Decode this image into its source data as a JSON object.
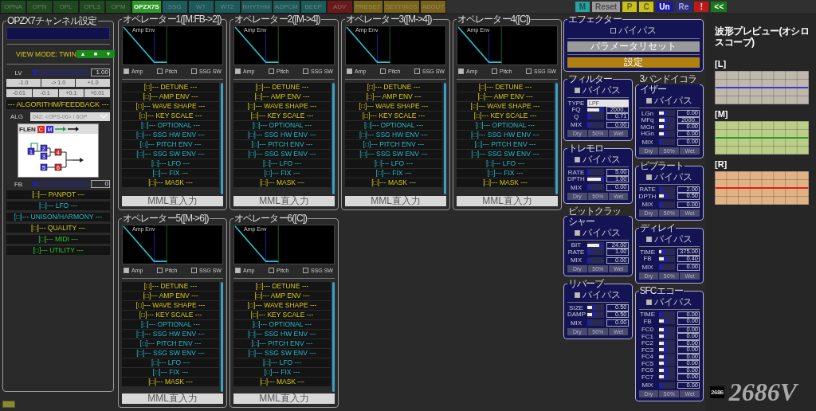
{
  "tabs": [
    {
      "label": "OPNA",
      "selected": false,
      "color": "#1e4a1e"
    },
    {
      "label": "OPN",
      "selected": false,
      "color": "#1e4a1e"
    },
    {
      "label": "OPL",
      "selected": false,
      "color": "#1e4a1e"
    },
    {
      "label": "OPL3",
      "selected": false,
      "color": "#1e4a1e"
    },
    {
      "label": "OPM",
      "selected": false,
      "color": "#1e4a1e"
    },
    {
      "label": "OPZX7S",
      "selected": true,
      "color": "#2e9a2e"
    },
    {
      "label": "SSG",
      "selected": false,
      "color": "#1d5a5a"
    },
    {
      "label": "WT",
      "selected": false,
      "color": "#1d5a5a"
    },
    {
      "label": "WT2",
      "selected": false,
      "color": "#1d5a5a"
    },
    {
      "label": "RHYTHM",
      "selected": false,
      "color": "#1d5a5a"
    },
    {
      "label": "ADPCM",
      "selected": false,
      "color": "#1d5a5a"
    },
    {
      "label": "BEEP",
      "selected": false,
      "color": "#1d5a5a"
    },
    {
      "label": "ADV",
      "selected": false,
      "color": "#6a1a1a"
    },
    {
      "label": "PRESET",
      "selected": false,
      "color": "#7a6418"
    },
    {
      "label": "SETTINGS",
      "selected": false,
      "color": "#7a6418"
    },
    {
      "label": "ABOUT",
      "selected": false,
      "color": "#7a6418"
    }
  ],
  "toolbar_buttons": [
    {
      "label": "M",
      "color": "#2aa0a0",
      "disabled": true
    },
    {
      "label": "Reset",
      "color": "#9a9a9a",
      "disabled": true
    },
    {
      "label": "P",
      "color": "#c8c020",
      "disabled": true
    },
    {
      "label": "C",
      "color": "#c8c020",
      "disabled": true
    },
    {
      "label": "Un",
      "color": "#1a1aa0",
      "disabled": false
    },
    {
      "label": "Re",
      "color": "#2a2a80",
      "disabled": true
    },
    {
      "label": "!",
      "color": "#c01818",
      "disabled": false
    },
    {
      "label": "<<",
      "color": "#1a7a1a",
      "disabled": false
    }
  ],
  "channel_panel": {
    "title": "OPZX7チャンネル設定",
    "view_mode": "VIEW MODE: TWIN",
    "view_buttons": [
      "▲",
      "■",
      "▼"
    ],
    "lv": {
      "label": "LV",
      "level": 0.05,
      "value": "1.00"
    },
    "step_buttons": [
      [
        "-1.0",
        "-> 1.0",
        "+1.0"
      ],
      [
        "-0.01",
        "-0.1",
        "+0.1",
        "+0.01"
      ]
    ],
    "algorithm_header": "--- ALGORITHM/FEEDBACK ---",
    "alg": {
      "label": "ALG",
      "value": "042: <OPS-06> / 6OP"
    },
    "diagram": {
      "label": "FLEN",
      "tools": [
        {
          "label": "C",
          "kind": "carrier"
        },
        {
          "label": "M",
          "kind": "modulator"
        }
      ],
      "nodes": [
        {
          "label": "1",
          "kind": "modulator"
        },
        {
          "label": "2",
          "kind": "modulator"
        },
        {
          "label": "3",
          "kind": "modulator"
        },
        {
          "label": "4",
          "kind": "carrier"
        },
        {
          "label": "5",
          "kind": "modulator"
        },
        {
          "label": "6",
          "kind": "carrier"
        }
      ]
    },
    "fb": {
      "label": "FB",
      "level": 0.0,
      "value": "0"
    },
    "sections": [
      {
        "label": "[□]--- PANPOT ---",
        "kind": "primary"
      },
      {
        "label": "[□]--- LFO ---",
        "kind": "extended"
      },
      {
        "label": "[□]--- UNISON/HARMONY ---",
        "kind": "extended"
      },
      {
        "label": "[□]--- QUALITY ---",
        "kind": "primary"
      },
      {
        "label": "[□]--- MIDI ---",
        "kind": "system"
      },
      {
        "label": "[□]--- UTILITY ---",
        "kind": "system"
      }
    ]
  },
  "operators": [
    {
      "title": "オペレーター1([M:FB->2])",
      "graph_label": "Amp Env",
      "checks": [
        {
          "label": "Amp",
          "checked": true
        },
        {
          "label": "Pitch",
          "checked": false
        },
        {
          "label": "SSG SW",
          "checked": false
        }
      ],
      "sections": [
        {
          "label": "[□]--- DETUNE ---",
          "kind": "primary"
        },
        {
          "label": "[□]--- AMP ENV ---",
          "kind": "primary"
        },
        {
          "label": "[□]--- WAVE SHAPE ---",
          "kind": "primary"
        },
        {
          "label": "[□]--- KEY SCALE ---",
          "kind": "primary"
        },
        {
          "label": "[□]--- OPTIONAL ---",
          "kind": "extended"
        },
        {
          "label": "[□]--- SSG HW ENV ---",
          "kind": "extended"
        },
        {
          "label": "[□]--- PITCH ENV ---",
          "kind": "extended"
        },
        {
          "label": "[□]--- SSG SW ENV ---",
          "kind": "extended"
        },
        {
          "label": "[□]--- LFO ---",
          "kind": "extended"
        },
        {
          "label": "[□]--- FIX ---",
          "kind": "extended"
        },
        {
          "label": "[□]--- MASK ---",
          "kind": "primary"
        }
      ],
      "mml_button": "MML直入力"
    },
    {
      "title": "オペレーター2([M->4])",
      "graph_label": "Amp Env",
      "checks": [
        {
          "label": "Amp",
          "checked": true
        },
        {
          "label": "Pitch",
          "checked": false
        },
        {
          "label": "SSG SW",
          "checked": false
        }
      ],
      "sections": [
        {
          "label": "[□]--- DETUNE ---",
          "kind": "primary"
        },
        {
          "label": "[□]--- AMP ENV ---",
          "kind": "primary"
        },
        {
          "label": "[□]--- WAVE SHAPE ---",
          "kind": "primary"
        },
        {
          "label": "[□]--- KEY SCALE ---",
          "kind": "primary"
        },
        {
          "label": "[□]--- OPTIONAL ---",
          "kind": "extended"
        },
        {
          "label": "[□]--- SSG HW ENV ---",
          "kind": "extended"
        },
        {
          "label": "[□]--- PITCH ENV ---",
          "kind": "extended"
        },
        {
          "label": "[□]--- SSG SW ENV ---",
          "kind": "extended"
        },
        {
          "label": "[□]--- LFO ---",
          "kind": "extended"
        },
        {
          "label": "[□]--- FIX ---",
          "kind": "extended"
        },
        {
          "label": "[□]--- MASK ---",
          "kind": "primary"
        }
      ],
      "mml_button": "MML直入力"
    },
    {
      "title": "オペレーター3([M->4])",
      "graph_label": "Amp Env",
      "checks": [
        {
          "label": "Amp",
          "checked": true
        },
        {
          "label": "Pitch",
          "checked": false
        },
        {
          "label": "SSG SW",
          "checked": false
        }
      ],
      "sections": [
        {
          "label": "[□]--- DETUNE ---",
          "kind": "primary"
        },
        {
          "label": "[□]--- AMP ENV ---",
          "kind": "primary"
        },
        {
          "label": "[□]--- WAVE SHAPE ---",
          "kind": "primary"
        },
        {
          "label": "[□]--- KEY SCALE ---",
          "kind": "primary"
        },
        {
          "label": "[□]--- OPTIONAL ---",
          "kind": "extended"
        },
        {
          "label": "[□]--- SSG HW ENV ---",
          "kind": "extended"
        },
        {
          "label": "[□]--- PITCH ENV ---",
          "kind": "extended"
        },
        {
          "label": "[□]--- SSG SW ENV ---",
          "kind": "extended"
        },
        {
          "label": "[□]--- LFO ---",
          "kind": "extended"
        },
        {
          "label": "[□]--- FIX ---",
          "kind": "extended"
        },
        {
          "label": "[□]--- MASK ---",
          "kind": "primary"
        }
      ],
      "mml_button": "MML直入力"
    },
    {
      "title": "オペレーター4([C])",
      "graph_label": "Amp Env",
      "checks": [
        {
          "label": "Amp",
          "checked": true
        },
        {
          "label": "Pitch",
          "checked": false
        },
        {
          "label": "SSG SW",
          "checked": false
        }
      ],
      "sections": [
        {
          "label": "[□]--- DETUNE ---",
          "kind": "primary"
        },
        {
          "label": "[□]--- AMP ENV ---",
          "kind": "primary"
        },
        {
          "label": "[□]--- WAVE SHAPE ---",
          "kind": "primary"
        },
        {
          "label": "[□]--- KEY SCALE ---",
          "kind": "primary"
        },
        {
          "label": "[□]--- OPTIONAL ---",
          "kind": "extended"
        },
        {
          "label": "[□]--- SSG HW ENV ---",
          "kind": "extended"
        },
        {
          "label": "[□]--- PITCH ENV ---",
          "kind": "extended"
        },
        {
          "label": "[□]--- SSG SW ENV ---",
          "kind": "extended"
        },
        {
          "label": "[□]--- LFO ---",
          "kind": "extended"
        },
        {
          "label": "[□]--- FIX ---",
          "kind": "extended"
        },
        {
          "label": "[□]--- MASK ---",
          "kind": "primary"
        }
      ],
      "mml_button": "MML直入力"
    },
    {
      "title": "オペレーター5([M->6])",
      "graph_label": "Amp Env",
      "checks": [
        {
          "label": "Amp",
          "checked": true
        },
        {
          "label": "Pitch",
          "checked": false
        },
        {
          "label": "SSG SW",
          "checked": false
        }
      ],
      "sections": [
        {
          "label": "[□]--- DETUNE ---",
          "kind": "primary"
        },
        {
          "label": "[□]--- AMP ENV ---",
          "kind": "primary"
        },
        {
          "label": "[□]--- WAVE SHAPE ---",
          "kind": "primary"
        },
        {
          "label": "[□]--- KEY SCALE ---",
          "kind": "primary"
        },
        {
          "label": "[□]--- OPTIONAL ---",
          "kind": "extended"
        },
        {
          "label": "[□]--- SSG HW ENV ---",
          "kind": "extended"
        },
        {
          "label": "[□]--- PITCH ENV ---",
          "kind": "extended"
        },
        {
          "label": "[□]--- SSG SW ENV ---",
          "kind": "extended"
        },
        {
          "label": "[□]--- LFO ---",
          "kind": "extended"
        },
        {
          "label": "[□]--- FIX ---",
          "kind": "extended"
        },
        {
          "label": "[□]--- MASK ---",
          "kind": "primary"
        }
      ],
      "mml_button": "MML直入力"
    },
    {
      "title": "オペレーター6([C])",
      "graph_label": "Amp Env",
      "checks": [
        {
          "label": "Amp",
          "checked": true
        },
        {
          "label": "Pitch",
          "checked": false
        },
        {
          "label": "SSG SW",
          "checked": false
        }
      ],
      "sections": [
        {
          "label": "[□]--- DETUNE ---",
          "kind": "primary"
        },
        {
          "label": "[□]--- AMP ENV ---",
          "kind": "primary"
        },
        {
          "label": "[□]--- WAVE SHAPE ---",
          "kind": "primary"
        },
        {
          "label": "[□]--- KEY SCALE ---",
          "kind": "primary"
        },
        {
          "label": "[□]--- OPTIONAL ---",
          "kind": "extended"
        },
        {
          "label": "[□]--- SSG HW ENV ---",
          "kind": "extended"
        },
        {
          "label": "[□]--- PITCH ENV ---",
          "kind": "extended"
        },
        {
          "label": "[□]--- SSG SW ENV ---",
          "kind": "extended"
        },
        {
          "label": "[□]--- LFO ---",
          "kind": "extended"
        },
        {
          "label": "[□]--- FIX ---",
          "kind": "extended"
        },
        {
          "label": "[□]--- MASK ---",
          "kind": "primary"
        }
      ],
      "mml_button": "MML直入力"
    }
  ],
  "effects": {
    "title": "エフェクター",
    "bypass": {
      "label": "バイパス",
      "checked": false
    },
    "buttons": [
      {
        "label": "パラメータリセット",
        "kind": "reset"
      },
      {
        "label": "設定",
        "kind": "settings"
      }
    ],
    "columns": [
      [
        {
          "title": "フィルター",
          "bypass": {
            "label": "バイパス",
            "checked": true
          },
          "groups": [
            [
              {
                "label": "TYPE",
                "kind": "select",
                "value": "LPF"
              },
              {
                "label": "FQ",
                "kind": "slider",
                "level": 0.95,
                "value": "2000.."
              },
              {
                "label": "Q",
                "kind": "slider",
                "level": 0.05,
                "value": "0.71"
              }
            ],
            [
              {
                "label": "MIX",
                "kind": "slider",
                "level": 0.0,
                "value": "0.00"
              }
            ]
          ],
          "mix_buttons": [
            {
              "label": "Dry",
              "disabled": true
            },
            {
              "label": "50%",
              "disabled": true
            },
            {
              "label": "Wet",
              "disabled": true
            }
          ]
        },
        {
          "title": "トレモロ",
          "bypass": {
            "label": "バイパス",
            "checked": true
          },
          "groups": [
            [
              {
                "label": "RATE",
                "kind": "slider",
                "level": 0.2,
                "value": "5.00"
              },
              {
                "label": "DPTH",
                "kind": "slider",
                "level": 1.0,
                "value": "1.00"
              }
            ],
            [
              {
                "label": "MIX",
                "kind": "slider",
                "level": 0.0,
                "value": "0.00"
              }
            ]
          ],
          "mix_buttons": [
            {
              "label": "Dry",
              "disabled": true
            },
            {
              "label": "50%",
              "disabled": true
            },
            {
              "label": "Wet",
              "disabled": true
            }
          ]
        },
        {
          "title": "ビットクラッシャー",
          "bypass": {
            "label": "バイパス",
            "checked": true
          },
          "groups": [
            [
              {
                "label": "BIT",
                "kind": "slider",
                "level": 0.95,
                "value": "24.00"
              },
              {
                "label": "RATE",
                "kind": "slider",
                "level": 0.0,
                "value": "1.00"
              }
            ],
            [
              {
                "label": "MIX",
                "kind": "slider",
                "level": 0.0,
                "value": "0.00"
              }
            ]
          ],
          "mix_buttons": [
            {
              "label": "Dry",
              "disabled": true
            },
            {
              "label": "50%",
              "disabled": true
            },
            {
              "label": "Wet",
              "disabled": true
            }
          ]
        },
        {
          "title": "リバーブ",
          "bypass": {
            "label": "バイパス",
            "checked": true
          },
          "groups": [
            [
              {
                "label": "SIZE",
                "kind": "slider",
                "level": 0.5,
                "value": "0.50"
              },
              {
                "label": "DAMP",
                "kind": "slider",
                "level": 0.5,
                "value": "0.50"
              }
            ],
            [
              {
                "label": "MIX",
                "kind": "slider",
                "level": 0.0,
                "value": "0.00"
              }
            ]
          ],
          "mix_buttons": [
            {
              "label": "Dry",
              "disabled": true
            },
            {
              "label": "50%",
              "disabled": true
            },
            {
              "label": "Wet",
              "disabled": true
            }
          ]
        }
      ],
      [
        {
          "title": "3バンドイコライザー",
          "bypass": {
            "label": "バイパス",
            "checked": true
          },
          "groups": [
            [
              {
                "label": "LGn",
                "kind": "slider",
                "level": 0.5,
                "value": "0.00"
              },
              {
                "label": "MFq",
                "kind": "slider",
                "level": 0.55,
                "value": "2000.."
              },
              {
                "label": "MGn",
                "kind": "slider",
                "level": 0.5,
                "value": "0.00"
              },
              {
                "label": "HGn",
                "kind": "slider",
                "level": 0.5,
                "value": "0.00"
              }
            ],
            [
              {
                "label": "MIX",
                "kind": "slider",
                "level": 0.0,
                "value": "0.00"
              }
            ]
          ],
          "mix_buttons": [
            {
              "label": "Dry",
              "disabled": true
            },
            {
              "label": "50%",
              "disabled": true
            },
            {
              "label": "Wet",
              "disabled": true
            }
          ]
        },
        {
          "title": "ビブラート",
          "bypass": {
            "label": "バイパス",
            "checked": true
          },
          "groups": [
            [
              {
                "label": "RATE",
                "kind": "slider",
                "level": 0.1,
                "value": "2.00"
              },
              {
                "label": "DPTH",
                "kind": "slider",
                "level": 0.5,
                "value": "0.50"
              }
            ],
            [
              {
                "label": "MIX",
                "kind": "slider",
                "level": 0.0,
                "value": "0.00"
              }
            ]
          ],
          "mix_buttons": [
            {
              "label": "Dry",
              "disabled": true
            },
            {
              "label": "50%",
              "disabled": true
            },
            {
              "label": "Wet",
              "disabled": true
            }
          ]
        },
        {
          "title": "ディレイ",
          "bypass": {
            "label": "バイパス",
            "checked": true
          },
          "groups": [
            [
              {
                "label": "TIME",
                "kind": "slider",
                "level": 0.35,
                "value": "375.00"
              },
              {
                "label": "FB",
                "kind": "slider",
                "level": 0.5,
                "value": "0.40"
              }
            ],
            [
              {
                "label": "MIX",
                "kind": "slider",
                "level": 0.0,
                "value": "0.00"
              }
            ]
          ],
          "mix_buttons": [
            {
              "label": "Dry",
              "disabled": true
            },
            {
              "label": "50%",
              "disabled": true
            },
            {
              "label": "Wet",
              "disabled": true
            }
          ]
        },
        {
          "title": "SFCエコー",
          "bypass": {
            "label": "バイパス",
            "checked": true
          },
          "groups": [
            [
              {
                "label": "TIME",
                "kind": "slider",
                "level": 0.0,
                "value": "0.00"
              },
              {
                "label": "FB",
                "kind": "slider",
                "level": 0.5,
                "value": "0.00"
              }
            ],
            [
              {
                "label": "FC0",
                "kind": "slider",
                "level": 0.5,
                "value": "0.00"
              },
              {
                "label": "FC1",
                "kind": "slider",
                "level": 0.5,
                "value": "0.00"
              },
              {
                "label": "FC2",
                "kind": "slider",
                "level": 0.5,
                "value": "0.00"
              },
              {
                "label": "FC3",
                "kind": "slider",
                "level": 0.5,
                "value": "0.00"
              },
              {
                "label": "FC4",
                "kind": "slider",
                "level": 0.5,
                "value": "0.00"
              },
              {
                "label": "FC5",
                "kind": "slider",
                "level": 0.5,
                "value": "0.00"
              },
              {
                "label": "FC6",
                "kind": "slider",
                "level": 0.5,
                "value": "0.00"
              },
              {
                "label": "FC7",
                "kind": "slider",
                "level": 0.5,
                "value": "0.00"
              }
            ],
            [
              {
                "label": "MIX",
                "kind": "slider",
                "level": 0.0,
                "value": "0.00"
              }
            ]
          ],
          "mix_buttons": [
            {
              "label": "Dry",
              "disabled": true
            },
            {
              "label": "50%",
              "disabled": true
            },
            {
              "label": "Wet",
              "disabled": true
            }
          ]
        }
      ]
    ]
  },
  "logo": {
    "badge": "2686",
    "text": "2686V"
  },
  "scope_panel": {
    "title": "波形プレビュー(オシロスコープ)",
    "scopes": [
      {
        "label": "[L]",
        "color": "#3a3ad8"
      },
      {
        "label": "[M]",
        "color": "#2a9a2a"
      },
      {
        "label": "[R]",
        "color": "#d82020"
      }
    ]
  }
}
